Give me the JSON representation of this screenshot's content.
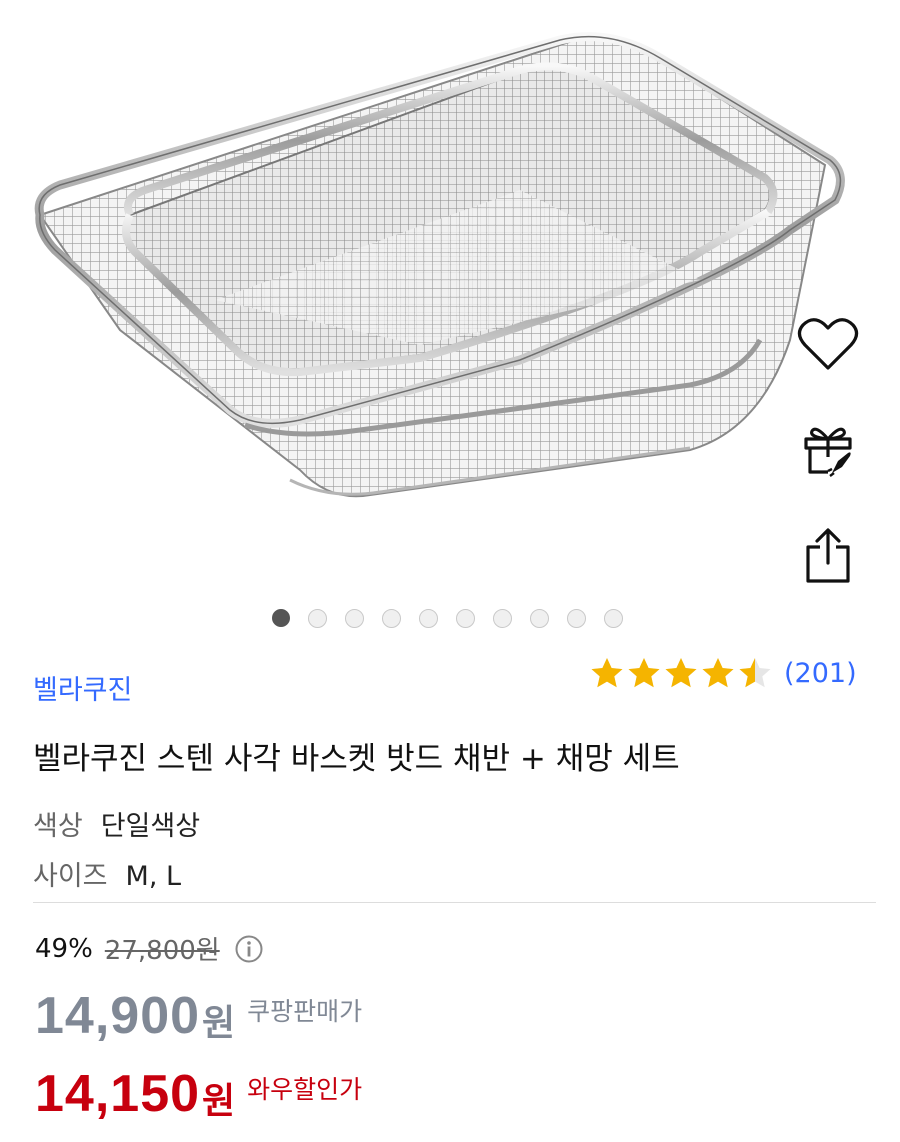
{
  "product_image": {
    "alt": "stainless basket set"
  },
  "side_actions": [
    {
      "name": "wishlist",
      "icon": "heart-icon"
    },
    {
      "name": "gift",
      "icon": "gift-rocket-icon"
    },
    {
      "name": "share",
      "icon": "share-icon"
    }
  ],
  "carousel": {
    "total": 10,
    "active_index": 0
  },
  "brand": "벨라쿠진",
  "rating": {
    "stars": 4.5,
    "max": 5,
    "review_count": "(201)"
  },
  "title": "벨라쿠진 스텐 사각 바스켓 밧드 채반 + 채망 세트",
  "options": [
    {
      "key": "색상",
      "value": "단일색상"
    },
    {
      "key": "사이즈",
      "value": "M, L"
    }
  ],
  "discount": {
    "percent": "49%",
    "original_price": "27,800원"
  },
  "prices": [
    {
      "amount": "14,900",
      "unit": "원",
      "label": "쿠팡판매가"
    },
    {
      "amount": "14,150",
      "unit": "원",
      "label": "와우할인가"
    }
  ],
  "colors": {
    "accent_blue": "#346aff",
    "star": "#f5b400",
    "sale_red": "#c7000e",
    "price_gray": "#808895"
  }
}
